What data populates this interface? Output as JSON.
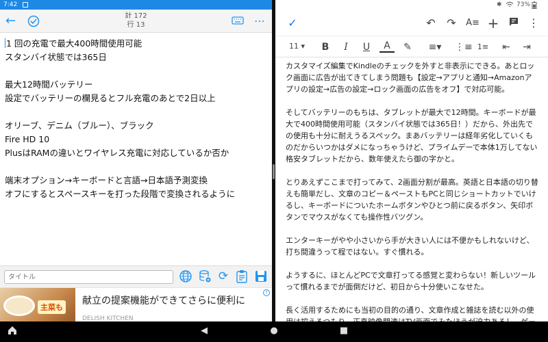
{
  "left_app": {
    "status_time": "7:42",
    "counts": {
      "total": "計 172",
      "line": "行 13"
    },
    "editor_lines": [
      "1 回の充電で最大400時間使用可能",
      "スタンバイ状態では365日",
      "",
      "最大12時間バッテリー",
      "設定でバッテリーの欄見るとフル充電のあとで2日以上",
      "",
      "オリーブ、デニム（ブルー）、ブラック",
      "Fire HD 10",
      "PlusはRAMの違いとワイヤレス充電に対応しているか否か",
      "",
      "端末オプション→キーボードと言語→日本語予測変換",
      "オフにするとスペースキーを打った段階で変換されるように"
    ],
    "title_placeholder": "タイトル",
    "ad": {
      "badge": "主菜も",
      "title": "献立の提案機能ができてさらに便利に",
      "brand": "DELISH KITCHEN"
    }
  },
  "right_app": {
    "battery": "73%",
    "font_size": "11",
    "paragraphs": [
      "カスタマイズ編集でKindleのチェックを外すと非表示にできる。あとロック画面に広告が出てきてしまう問題も【設定→アプリと通知→Amazonアプリの設定→広告の設定→ロック画面の広告をオフ】で対応可能。",
      "そしてバッテリーのもちは、タブレットが最大で12時間。キーボードが最大で400時間使用可能（スタンバイ状態では365日！）だから、外出先での使用も十分に耐えうるスペック。まあバッテリーは経年劣化していくものだからいつかはダメになっちゃうけど、プライムデーで本体1万してない格安タブレットだから、数年使えたら御の字かと。",
      "とりあえずここまで打ってみて、2画面分割が最高。英語と日本語の切り替えも簡単だし、文章のコピー＆ペーストもPCと同じショートカットでいけるし、キーボードについたホームボタンやひとつ前に戻るボタン、矢印ボタンでマウスがなくても操作性バツグン。",
      "エンターキーがやや小さいから手が大きい人には不便かもしれないけど、打ち間違うって程ではない。すぐ慣れる。",
      "ようするに、ほとんどPCで文章打ってる感覚と変わらない！新しいツールって慣れるまでが面倒だけど、初日から十分使いこなせた。",
      "長く活用するためにも当初の目的の通り、文章作成と雑誌を読む以外の使用は控えるつもり。正直映像関連はTV画面でみたほうが迫力あるし、ゲームとかで時間を潰すためにタブレットがほしかったわけでもない"
    ]
  },
  "colors": {
    "accent": "#2196f3",
    "status_bar": "#1e88e5"
  }
}
